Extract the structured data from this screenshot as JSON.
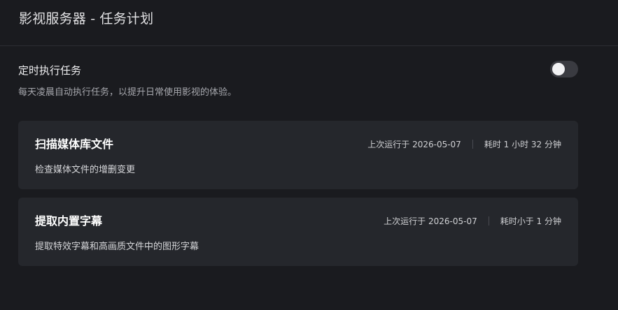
{
  "header": {
    "title": "影视服务器 - 任务计划"
  },
  "scheduled": {
    "title": "定时执行任务",
    "description": "每天凌晨自动执行任务，以提升日常使用影视的体验。",
    "enabled": false
  },
  "tasks": [
    {
      "title": "扫描媒体库文件",
      "description": "检查媒体文件的增删变更",
      "last_run": "上次运行于 2026-05-07",
      "duration": "耗时 1 小时 32 分钟"
    },
    {
      "title": "提取内置字幕",
      "description": "提取特效字幕和高画质文件中的图形字幕",
      "last_run": "上次运行于 2026-05-07",
      "duration": "耗时小于 1 分钟"
    }
  ]
}
